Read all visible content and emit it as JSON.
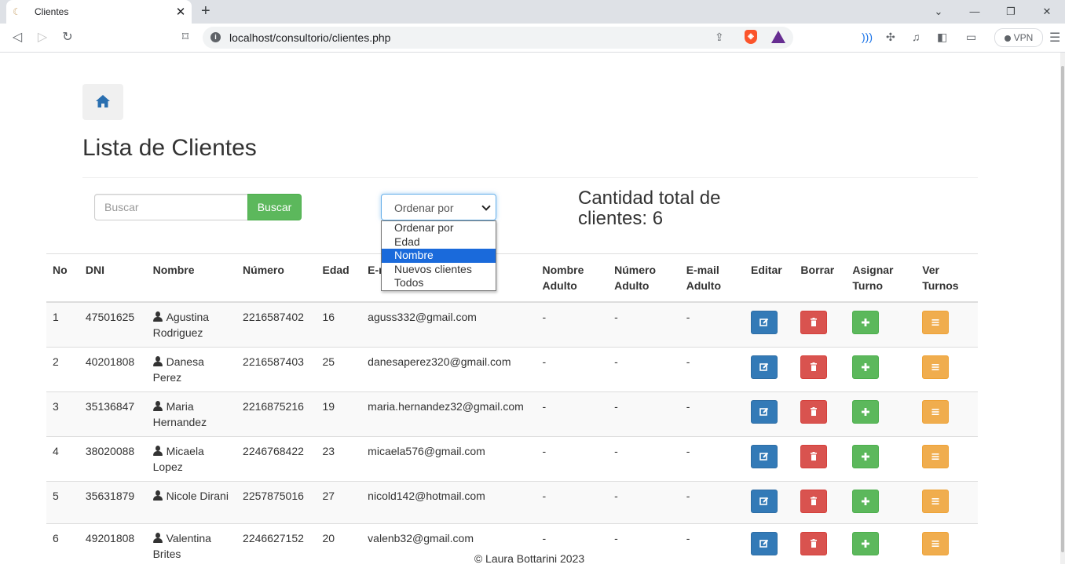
{
  "browser": {
    "tab_title": "Clientes",
    "url": "localhost/consultorio/clientes.php",
    "vpn_label": "VPN"
  },
  "page": {
    "title": "Lista de Clientes",
    "search_placeholder": "Buscar",
    "search_button": "Buscar",
    "sort_selected": "Ordenar por",
    "sort_options": [
      "Ordenar por",
      "Edad",
      "Nombre",
      "Nuevos clientes",
      "Todos"
    ],
    "sort_highlighted": "Nombre",
    "count_text": "Cantidad total de clientes: 6",
    "footer": "© Laura Bottarini 2023"
  },
  "table": {
    "headers": [
      "No",
      "DNI",
      "Nombre",
      "Número",
      "Edad",
      "E-mail",
      "Nombre Adulto",
      "Número Adulto",
      "E-mail Adulto",
      "Editar",
      "Borrar",
      "Asignar Turno",
      "Ver Turnos"
    ],
    "rows": [
      {
        "no": "1",
        "dni": "47501625",
        "nombre": "Agustina Rodriguez",
        "numero": "2216587402",
        "edad": "16",
        "email": "aguss332@gmail.com",
        "nombre_adulto": "-",
        "numero_adulto": "-",
        "email_adulto": "-"
      },
      {
        "no": "2",
        "dni": "40201808",
        "nombre": "Danesa Perez",
        "numero": "2216587403",
        "edad": "25",
        "email": "danesaperez320@gmail.com",
        "nombre_adulto": "-",
        "numero_adulto": "-",
        "email_adulto": "-"
      },
      {
        "no": "3",
        "dni": "35136847",
        "nombre": "Maria Hernandez",
        "numero": "2216875216",
        "edad": "19",
        "email": "maria.hernandez32@gmail.com",
        "nombre_adulto": "-",
        "numero_adulto": "-",
        "email_adulto": "-"
      },
      {
        "no": "4",
        "dni": "38020088",
        "nombre": "Micaela Lopez",
        "numero": "2246768422",
        "edad": "23",
        "email": "micaela576@gmail.com",
        "nombre_adulto": "-",
        "numero_adulto": "-",
        "email_adulto": "-"
      },
      {
        "no": "5",
        "dni": "35631879",
        "nombre": "Nicole Dirani",
        "numero": "2257875016",
        "edad": "27",
        "email": "nicold142@hotmail.com",
        "nombre_adulto": "-",
        "numero_adulto": "-",
        "email_adulto": "-"
      },
      {
        "no": "6",
        "dni": "49201808",
        "nombre": "Valentina Brites",
        "numero": "2246627152",
        "edad": "20",
        "email": "valenb32@gmail.com",
        "nombre_adulto": "-",
        "numero_adulto": "-",
        "email_adulto": "-"
      }
    ]
  }
}
